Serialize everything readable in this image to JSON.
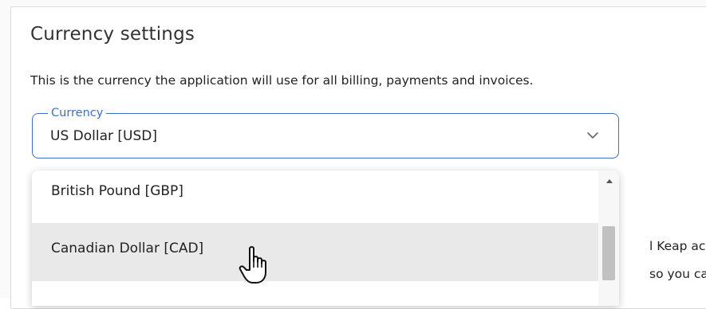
{
  "section": {
    "title": "Currency settings",
    "description": "This is the currency the application will use for all billing, payments and invoices."
  },
  "currency_field": {
    "label": "Currency",
    "value": "US Dollar [USD]"
  },
  "dropdown": {
    "options": [
      {
        "label": "British Pound [GBP]",
        "highlighted": false
      },
      {
        "label": "Canadian Dollar [CAD]",
        "highlighted": true
      }
    ]
  },
  "background_text": {
    "line1": "l Keap acco",
    "line2": "so you can r"
  },
  "colors": {
    "accent": "#3b6fd1",
    "highlight": "#e9e9e9"
  },
  "icons": {
    "chevron": "chevron-down-icon",
    "cursor": "hand-pointer-icon"
  }
}
